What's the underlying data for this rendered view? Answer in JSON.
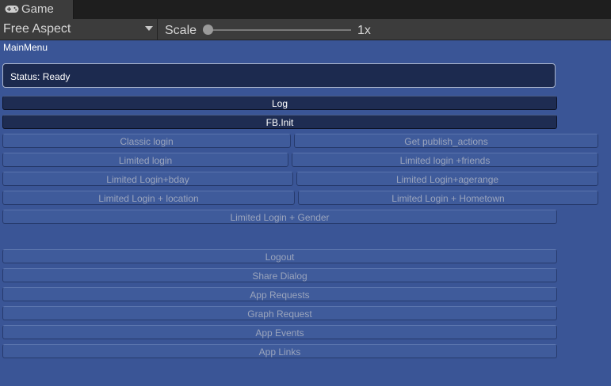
{
  "window": {
    "tab_label": "Game",
    "tab_icon": "gamepad-icon"
  },
  "toolbar": {
    "aspect_label": "Free Aspect",
    "scale_label": "Scale",
    "scale_value": "1x",
    "scale_slider_level": 0.0
  },
  "game": {
    "menu_title": "MainMenu",
    "status": "Status: Ready",
    "buttons": {
      "log": "Log",
      "fb_init": "FB.Init",
      "classic_login": "Classic login",
      "publish_actions": "Get publish_actions",
      "limited_login": "Limited login",
      "limited_login_friends": "Limited login +friends",
      "limited_login_bday": "Limited Login+bday",
      "limited_login_agerange": "Limited Login+agerange",
      "limited_login_location": "Limited Login + location",
      "limited_login_hometown": "Limited Login + Hometown",
      "limited_login_gender": "Limited Login + Gender",
      "logout": "Logout",
      "share_dialog": "Share Dialog",
      "app_requests": "App Requests",
      "graph_request": "Graph Request",
      "app_events": "App Events",
      "app_links": "App Links"
    }
  },
  "colors": {
    "game_background": "#3a5596",
    "active_button": "#1e2c52",
    "dim_button": "#3f5b9b",
    "dim_text": "#9aa4bc",
    "editor_dark": "#3c3c3c"
  }
}
